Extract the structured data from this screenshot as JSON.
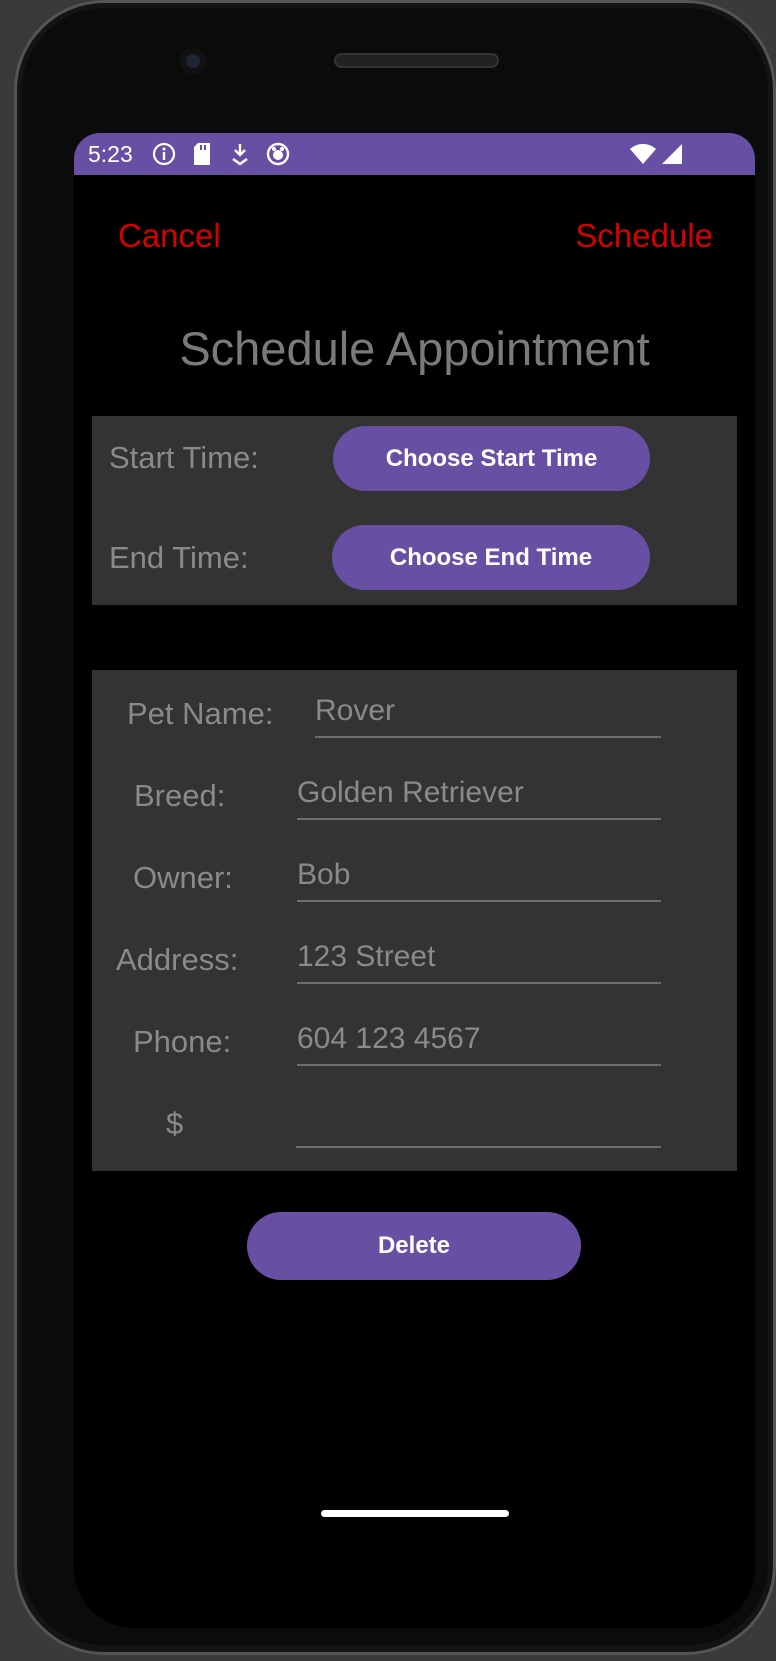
{
  "status_bar": {
    "time": "5:23",
    "icons": [
      "info-icon",
      "sd-card-icon",
      "download-icon",
      "app-icon"
    ],
    "right_icons": [
      "wifi-icon",
      "signal-icon"
    ],
    "color": "#6750a4"
  },
  "header": {
    "cancel_label": "Cancel",
    "schedule_label": "Schedule",
    "title": "Schedule Appointment",
    "link_color": "#d60000"
  },
  "time_panel": {
    "start_label": "Start Time:",
    "start_button": "Choose Start Time",
    "end_label": "End Time:",
    "end_button": "Choose End Time"
  },
  "details": {
    "pet_name_label": "Pet Name:",
    "pet_name_value": "Rover",
    "breed_label": "Breed:",
    "breed_value": "Golden Retriever",
    "owner_label": "Owner:",
    "owner_value": "Bob",
    "address_label": "Address:",
    "address_value": "123 Street",
    "phone_label": "Phone:",
    "phone_value": "604 123 4567",
    "price_label": "$",
    "price_value": ""
  },
  "actions": {
    "delete_label": "Delete",
    "accent": "#6750a4"
  }
}
